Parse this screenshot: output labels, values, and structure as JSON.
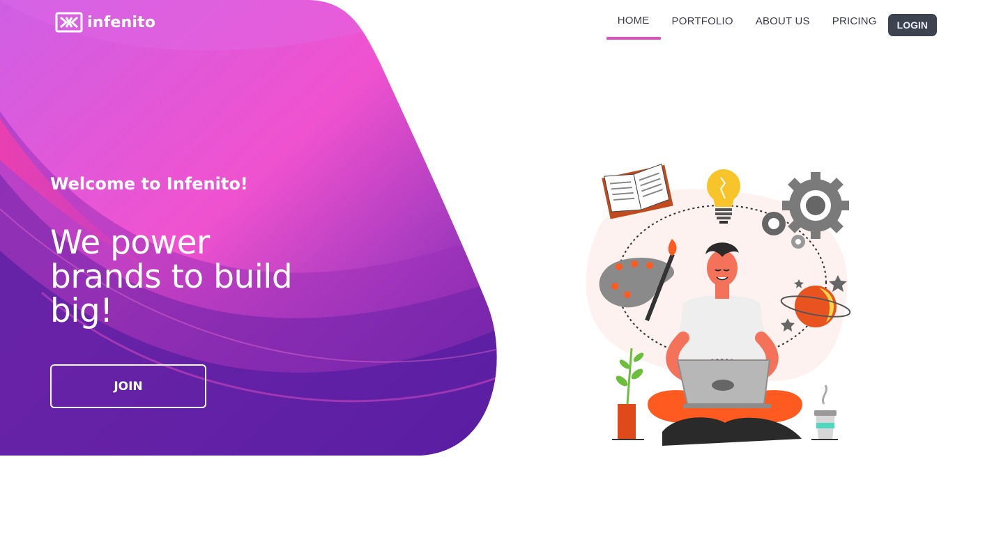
{
  "brand": {
    "name": "infenito"
  },
  "nav": {
    "items": [
      {
        "label": "HOME",
        "active": true
      },
      {
        "label": "PORTFOLIO",
        "active": false
      },
      {
        "label": "ABOUT US",
        "active": false
      },
      {
        "label": "PRICING",
        "active": false
      }
    ],
    "login_label": "LOGIN"
  },
  "hero": {
    "welcome": "Welcome to Infenito!",
    "headline": "We power brands to build big!",
    "join_label": "JOIN"
  },
  "colors": {
    "accent": "#e24fbf",
    "login_bg": "#3e4350",
    "gradient_top": "#d35ce0",
    "gradient_mid": "#ef4fc9",
    "gradient_bottom": "#4e1aa0"
  },
  "icons": [
    "logo-icon",
    "book-icon",
    "lightbulb-icon",
    "gear-icon",
    "palette-icon",
    "planet-icon",
    "star-icon",
    "plant-icon",
    "coffee-cup-icon",
    "laptop-icon"
  ]
}
